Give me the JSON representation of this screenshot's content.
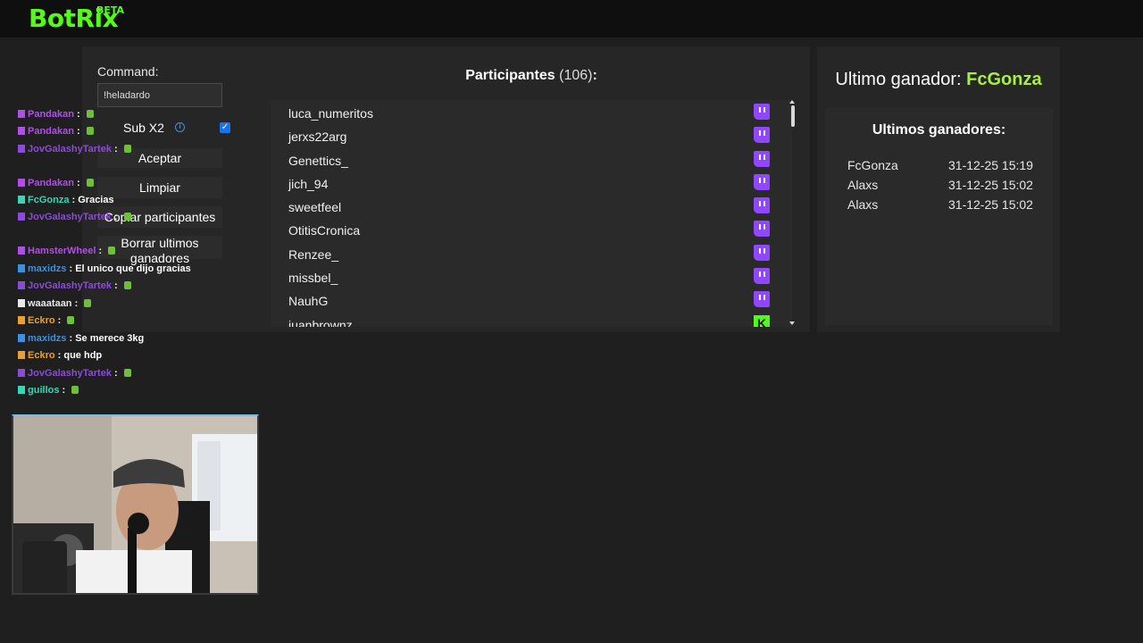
{
  "app": {
    "logo": "BotRix",
    "badge": "BETA"
  },
  "command": {
    "label": "Command:",
    "value": "!heladardo"
  },
  "sub_option": {
    "label": "Sub X2",
    "checked": true
  },
  "buttons": {
    "accept": "Aceptar",
    "clear": "Limpiar",
    "copy": "Copiar participantes",
    "delete": "Borrar ultimos ganadores"
  },
  "participants": {
    "title": "Participantes",
    "count": "(106)",
    "suffix": ":",
    "items": [
      {
        "name": "luca_numeritos",
        "platform": "twitch-icon"
      },
      {
        "name": "jerxs22arg",
        "platform": "twitch-icon"
      },
      {
        "name": "Genettics_",
        "platform": "twitch-icon"
      },
      {
        "name": "jich_94",
        "platform": "twitch-icon"
      },
      {
        "name": "sweetfeel",
        "platform": "twitch-icon"
      },
      {
        "name": "OtitisCronica",
        "platform": "twitch-icon"
      },
      {
        "name": "Renzee_",
        "platform": "twitch-icon"
      },
      {
        "name": "missbel_",
        "platform": "twitch-icon"
      },
      {
        "name": "NauhG",
        "platform": "twitch-icon"
      },
      {
        "name": "juanbrownz",
        "platform": "kick-icon"
      }
    ]
  },
  "last_winner": {
    "label": "Ultimo ganador:",
    "name": "FcGonza"
  },
  "recent_winners": {
    "title": "Ultimos ganadores:",
    "rows": [
      {
        "name": "FcGonza",
        "date": "31-12-25 15:19"
      },
      {
        "name": "Alaxs",
        "date": "31-12-25 15:02"
      },
      {
        "name": "Alaxs",
        "date": "31-12-25 15:02"
      }
    ]
  },
  "chat": [
    {
      "user": "Pandakan",
      "color": "#b04ee8",
      "text": ""
    },
    {
      "user": "Pandakan",
      "color": "#b04ee8",
      "text": ""
    },
    {
      "user": "JovGalashyTartek",
      "color": "#8b4bd6",
      "text": ""
    },
    {
      "user": "Pandakan",
      "color": "#b04ee8",
      "text": ""
    },
    {
      "user": "FcGonza",
      "color": "#37d6b4",
      "text": "Gracias"
    },
    {
      "user": "JovGalashyTartek",
      "color": "#8b4bd6",
      "text": ""
    },
    {
      "user": "HamsterWheel",
      "color": "#b04ee8",
      "text": ""
    },
    {
      "user": "maxidzs",
      "color": "#3d8fe0",
      "text": "El unico que dijo gracias"
    },
    {
      "user": "JovGalashyTartek",
      "color": "#8b4bd6",
      "text": ""
    },
    {
      "user": "waaataan",
      "color": "#e8e8e8",
      "text": ""
    },
    {
      "user": "Eckro",
      "color": "#e8a030",
      "text": ""
    },
    {
      "user": "maxidzs",
      "color": "#3d8fe0",
      "text": "Se merece 3kg"
    },
    {
      "user": "Eckro",
      "color": "#e8a030",
      "text": "que hdp"
    },
    {
      "user": "JovGalashyTartek",
      "color": "#8b4bd6",
      "text": ""
    },
    {
      "user": "guillos",
      "color": "#37d6b4",
      "text": ""
    }
  ]
}
